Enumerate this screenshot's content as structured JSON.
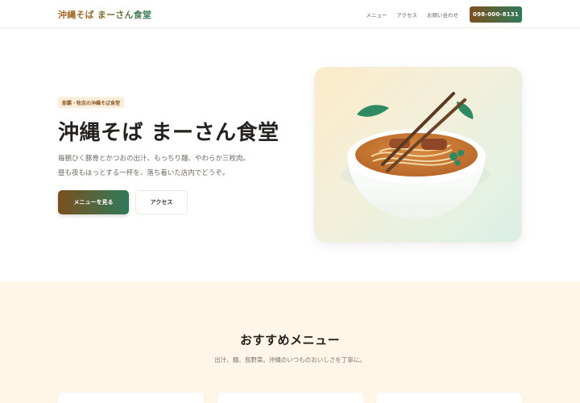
{
  "header": {
    "logo": "沖縄そば まーさん食堂",
    "nav": [
      "メニュー",
      "アクセス",
      "お問い合わせ"
    ],
    "phone": "098-000-8131"
  },
  "hero": {
    "badge": "那覇・牧志の沖縄そば食堂",
    "title": "沖縄そば まーさん食堂",
    "desc_lines": [
      "毎朝ひく豚骨とかつおの出汁、もっちり麺、やわらか三枚肉。",
      "昼も夜もほっとする一杯を、落ち着いた店内でどうぞ。"
    ],
    "primary_button": "メニューを見る",
    "secondary_button": "アクセス",
    "image_icon": "soba-bowl-illustration"
  },
  "recommend": {
    "title": "おすすめメニュー",
    "subtitle": "出汁、麺、島野菜。沖縄のいつものおいしさを丁寧に。"
  },
  "colors": {
    "brand_brown": "#7a4f1e",
    "brand_green": "#2f7a5a",
    "section_bg": "#fff6e7"
  }
}
